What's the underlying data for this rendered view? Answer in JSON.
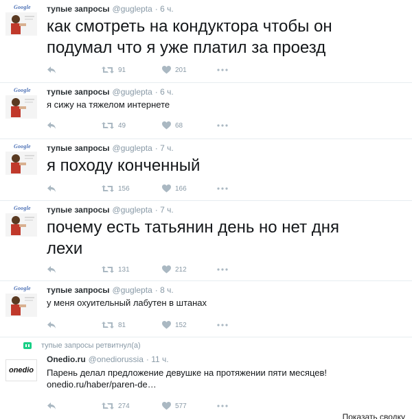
{
  "colors": {
    "text": "#14171a",
    "meta": "#8899a6",
    "retweet_green": "#19cf86",
    "divider": "#e6ecf0"
  },
  "icons": {
    "reply": "reply-icon",
    "retweet": "retweet-icon",
    "like": "heart-icon",
    "more": "more-icon"
  },
  "tweets": [
    {
      "avatar_logo": "Google",
      "name": "тупые запросы",
      "handle": "@guglepta",
      "time": "· 6 ч.",
      "lines": [
        "как смотреть на кондуктора чтобы он",
        "подумал что я уже платил за проезд"
      ],
      "retweets": "91",
      "likes": "201"
    },
    {
      "avatar_logo": "Google",
      "name": "тупые запросы",
      "handle": "@guglepta",
      "time": "· 6 ч.",
      "lines": [
        "я сижу на тяжелом интернете"
      ],
      "retweets": "49",
      "likes": "68"
    },
    {
      "avatar_logo": "Google",
      "name": "тупые запросы",
      "handle": "@guglepta",
      "time": "· 7 ч.",
      "lines": [
        "я походу конченный"
      ],
      "retweets": "156",
      "likes": "166"
    },
    {
      "avatar_logo": "Google",
      "name": "тупые запросы",
      "handle": "@guglepta",
      "time": "· 7 ч.",
      "lines": [
        "почему есть татьянин день но нет дня",
        "лехи"
      ],
      "retweets": "131",
      "likes": "212"
    },
    {
      "avatar_logo": "Google",
      "name": "тупые запросы",
      "handle": "@guglepta",
      "time": "· 8 ч.",
      "lines": [
        "у меня охуительный лабутен в штанах"
      ],
      "retweets": "81",
      "likes": "152"
    }
  ],
  "retweet": {
    "context": "тупые запросы ретвитнул(а)",
    "logo_text": "onedio",
    "name": "Onedio.ru",
    "handle": "@onediorussia",
    "time": "· 11 ч.",
    "lines": [
      "Парень делал предложение девушке на протяжении пяти месяцев!",
      "onedio.ru/haber/paren-de…"
    ],
    "retweets": "274",
    "likes": "577",
    "show_summary": "Показать сводку"
  }
}
